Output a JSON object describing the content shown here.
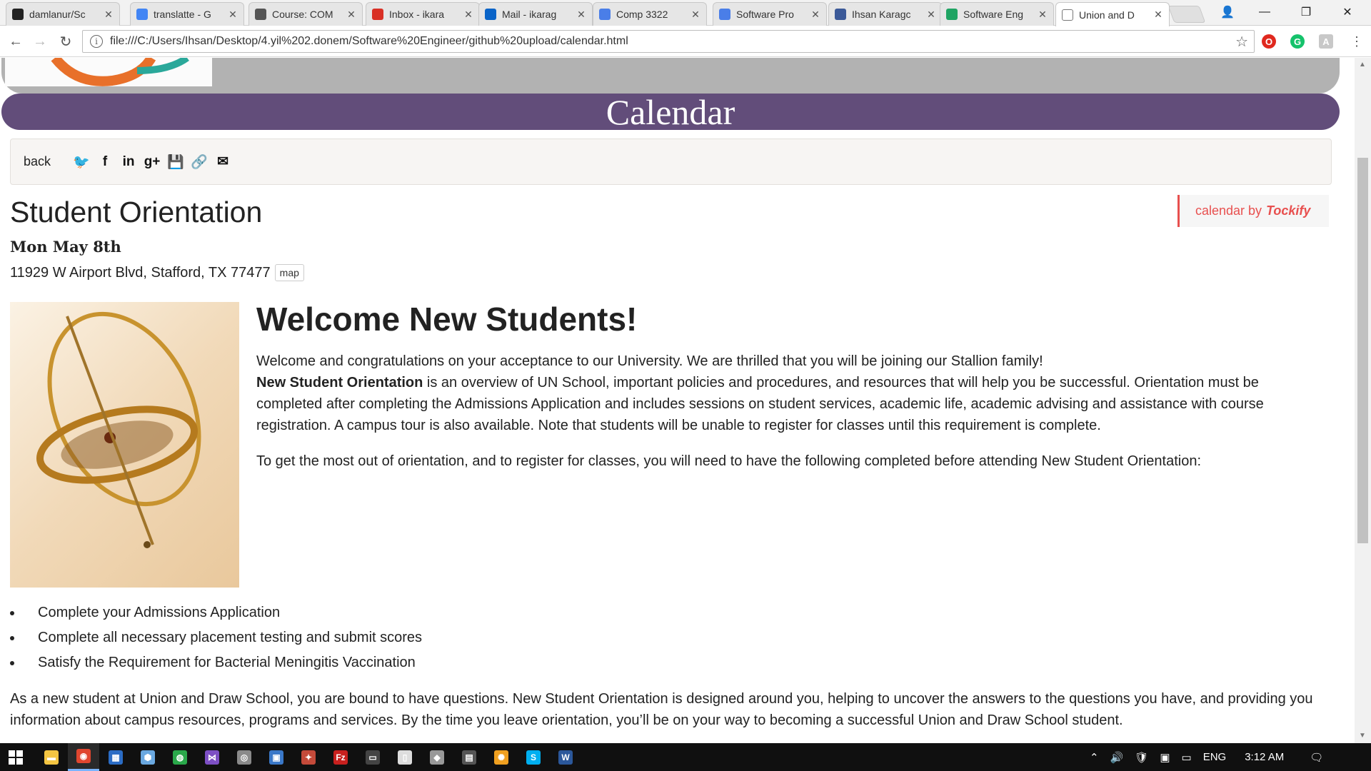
{
  "browser": {
    "tabs": [
      {
        "title": "damlanur/Sc",
        "icon": "github-icon",
        "color": "#222222"
      },
      {
        "title": "translatte - G",
        "icon": "google-icon",
        "color": "#4285f4"
      },
      {
        "title": "Course: COM",
        "icon": "moodle-icon",
        "color": "#555555"
      },
      {
        "title": "Inbox - ikara",
        "icon": "gmail-icon",
        "color": "#d93025"
      },
      {
        "title": "Mail - ikarag",
        "icon": "outlook-icon",
        "color": "#0a64c8"
      },
      {
        "title": "Comp 3322",
        "icon": "docs-icon",
        "color": "#4a7ee8"
      },
      {
        "title": "Software Pro",
        "icon": "docs-icon",
        "color": "#4a7ee8"
      },
      {
        "title": "Ihsan Karagc",
        "icon": "facebook-icon",
        "color": "#3b5998"
      },
      {
        "title": "Software Eng",
        "icon": "drive-icon",
        "color": "#1fa463"
      },
      {
        "title": "Union and D",
        "icon": "page-icon",
        "color": "#ffffff"
      }
    ],
    "url": "file:///C:/Users/Ihsan/Desktop/4.yil%202.donem/Software%20Engineer/github%20upload/calendar.html"
  },
  "page": {
    "banner_title": "Calendar",
    "back_label": "back",
    "share_icons": [
      "twitter-icon",
      "facebook-icon",
      "linkedin-icon",
      "google-plus-icon",
      "save-icon",
      "link-icon",
      "email-icon"
    ],
    "share_glyphs": [
      "🐦",
      "f",
      "in",
      "g+",
      "💾",
      "🔗",
      "✉"
    ],
    "event_title": "Student Orientation",
    "tockify_prefix": "calendar by",
    "tockify_brand": "Tockify",
    "event_date": "Mon May 8th",
    "event_address": "11929 W Airport Blvd, Stafford, TX 77477",
    "map_label": "map",
    "welcome_heading": "Welcome New Students!",
    "intro": "Welcome and congratulations on your acceptance to our University. We are thrilled that you will be joining our Stallion family!",
    "orientation_bold": "New Student Orientation",
    "orientation_text": " is an overview of UN School, important policies and procedures, and resources that will help you be successful. Orientation must be completed after completing the Admissions Application and includes sessions on student services, academic life, academic advising and assistance with course registration. A campus tour is also available. Note that students will be unable to register for classes until this requirement is complete.",
    "prep_text": "To get the most out of orientation, and to register for classes, you will need to have the following completed before attending New Student Orientation:",
    "requirements": [
      "Complete your Admissions Application",
      "Complete all necessary placement testing and submit scores",
      "Satisfy the Requirement for Bacterial Meningitis Vaccination"
    ],
    "closing": "As a new student at Union and Draw School, you are bound to have questions. New Student Orientation is designed around you, helping to uncover the answers to the questions you have, and providing you information about campus resources, programs and services. By the time you leave orientation, you’ll be on your way to becoming a successful Union and Draw School student."
  },
  "taskbar": {
    "apps": [
      {
        "name": "file-explorer-icon",
        "glyph": "▬",
        "color": "#f4c542"
      },
      {
        "name": "chrome-icon",
        "glyph": "◉",
        "color": "#e0462f"
      },
      {
        "name": "app-icon",
        "glyph": "▦",
        "color": "#2b6cc4"
      },
      {
        "name": "app-icon",
        "glyph": "⬢",
        "color": "#6aa8e0"
      },
      {
        "name": "app-icon",
        "glyph": "◍",
        "color": "#2aa84a"
      },
      {
        "name": "visual-studio-icon",
        "glyph": "⋈",
        "color": "#7d4fc4"
      },
      {
        "name": "app-icon",
        "glyph": "◎",
        "color": "#8a8a8a"
      },
      {
        "name": "app-icon",
        "glyph": "▣",
        "color": "#3a78c8"
      },
      {
        "name": "app-icon",
        "glyph": "✦",
        "color": "#c44a3a"
      },
      {
        "name": "filezilla-icon",
        "glyph": "Fz",
        "color": "#c8201e"
      },
      {
        "name": "terminal-icon",
        "glyph": "▭",
        "color": "#444444"
      },
      {
        "name": "notepad-icon",
        "glyph": "▯",
        "color": "#dddddd"
      },
      {
        "name": "app-icon",
        "glyph": "◆",
        "color": "#999999"
      },
      {
        "name": "calculator-icon",
        "glyph": "▤",
        "color": "#555555"
      },
      {
        "name": "app-icon",
        "glyph": "✺",
        "color": "#f0a020"
      },
      {
        "name": "skype-icon",
        "glyph": "S",
        "color": "#00aff0"
      },
      {
        "name": "word-icon",
        "glyph": "W",
        "color": "#2b579a"
      }
    ],
    "language": "ENG",
    "time": "3:12 AM"
  }
}
